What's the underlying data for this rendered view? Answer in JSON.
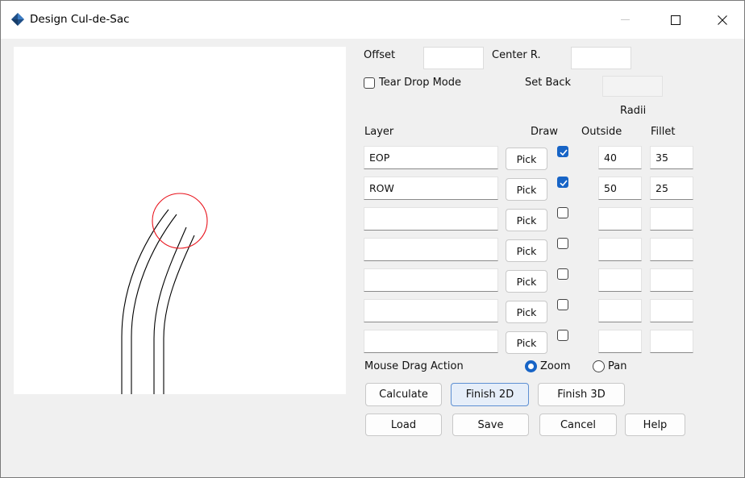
{
  "window": {
    "title": "Design Cul-de-Sac"
  },
  "offset": {
    "label": "Offset",
    "value": ""
  },
  "center_r": {
    "label": "Center R.",
    "value": ""
  },
  "tear_drop": {
    "label": "Tear Drop Mode",
    "checked": false
  },
  "set_back": {
    "label": "Set Back",
    "value": ""
  },
  "headers": {
    "radii": "Radii",
    "layer": "Layer",
    "draw": "Draw",
    "outside": "Outside",
    "fillet": "Fillet"
  },
  "pick_label": "Pick",
  "rows": [
    {
      "layer": "EOP",
      "draw": true,
      "outside": "40",
      "fillet": "35"
    },
    {
      "layer": "ROW",
      "draw": true,
      "outside": "50",
      "fillet": "25"
    },
    {
      "layer": "",
      "draw": false,
      "outside": "",
      "fillet": ""
    },
    {
      "layer": "",
      "draw": false,
      "outside": "",
      "fillet": ""
    },
    {
      "layer": "",
      "draw": false,
      "outside": "",
      "fillet": ""
    },
    {
      "layer": "",
      "draw": false,
      "outside": "",
      "fillet": ""
    },
    {
      "layer": "",
      "draw": false,
      "outside": "",
      "fillet": ""
    }
  ],
  "mouse_drag": {
    "label": "Mouse Drag Action",
    "zoom": "Zoom",
    "pan": "Pan",
    "selected": "Zoom"
  },
  "buttons": {
    "calculate": "Calculate",
    "finish2d": "Finish 2D",
    "finish3d": "Finish 3D",
    "load": "Load",
    "save": "Save",
    "cancel": "Cancel",
    "help": "Help"
  },
  "colors": {
    "accent": "#1764c6",
    "circle": "#e8121b",
    "focus_border": "#5d8fd2"
  },
  "icons": {
    "app": "autodesk-diamond-icon",
    "minimize": "minimize-icon",
    "maximize": "maximize-icon",
    "close": "close-icon"
  }
}
